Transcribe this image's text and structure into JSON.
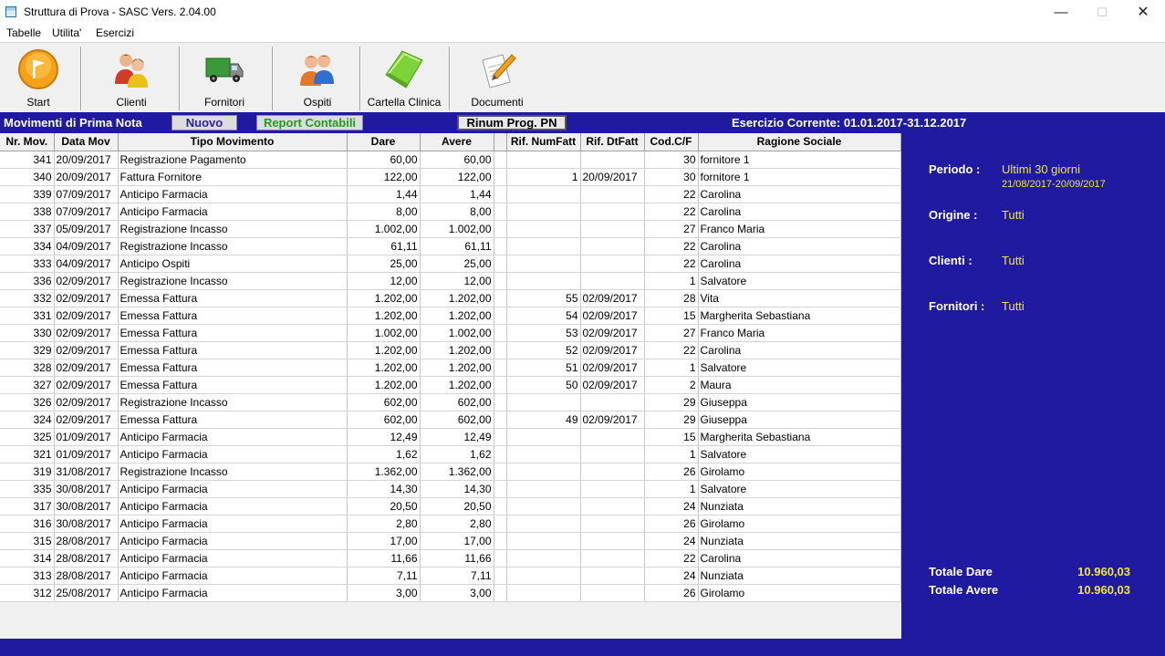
{
  "window": {
    "title": "Struttura di Prova - SASC Vers. 2.04.00",
    "minimize": "—",
    "maximize": "☐",
    "close": "✕"
  },
  "menu": [
    "Tabelle",
    "Utilita'",
    "Esercizi"
  ],
  "toolbar": {
    "start": "Start",
    "clienti": "Clienti",
    "fornitori": "Fornitori",
    "ospiti": "Ospiti",
    "cartella": "Cartella Clinica",
    "documenti": "Documenti"
  },
  "strip": {
    "title": "Movimenti di Prima Nota",
    "nuovo": "Nuovo",
    "report": "Report Contabili",
    "rinum": "Rinum Prog. PN",
    "esercizio": "Esercizio Corrente: 01.01.2017-31.12.2017"
  },
  "columns": [
    "Nr. Mov.",
    "Data Mov",
    "Tipo Movimento",
    "Dare",
    "Avere",
    "",
    "Rif. NumFatt",
    "Rif. DtFatt",
    "Cod.C/F",
    "Ragione Sociale"
  ],
  "rows": [
    [
      "341",
      "20/09/2017",
      "Registrazione Pagamento",
      "60,00",
      "60,00",
      "",
      "",
      "",
      "30",
      "fornitore 1"
    ],
    [
      "340",
      "20/09/2017",
      "Fattura Fornitore",
      "122,00",
      "122,00",
      "",
      "1",
      "20/09/2017",
      "30",
      "fornitore 1"
    ],
    [
      "339",
      "07/09/2017",
      "Anticipo Farmacia",
      "1,44",
      "1,44",
      "",
      "",
      "",
      "22",
      "Carolina"
    ],
    [
      "338",
      "07/09/2017",
      "Anticipo Farmacia",
      "8,00",
      "8,00",
      "",
      "",
      "",
      "22",
      "Carolina"
    ],
    [
      "337",
      "05/09/2017",
      "Registrazione Incasso",
      "1.002,00",
      "1.002,00",
      "",
      "",
      "",
      "27",
      "Franco Maria"
    ],
    [
      "334",
      "04/09/2017",
      "Registrazione Incasso",
      "61,11",
      "61,11",
      "",
      "",
      "",
      "22",
      "Carolina"
    ],
    [
      "333",
      "04/09/2017",
      "Anticipo Ospiti",
      "25,00",
      "25,00",
      "",
      "",
      "",
      "22",
      "Carolina"
    ],
    [
      "336",
      "02/09/2017",
      "Registrazione Incasso",
      "12,00",
      "12,00",
      "",
      "",
      "",
      "1",
      "Salvatore"
    ],
    [
      "332",
      "02/09/2017",
      "Emessa Fattura",
      "1.202,00",
      "1.202,00",
      "",
      "55",
      "02/09/2017",
      "28",
      "Vita"
    ],
    [
      "331",
      "02/09/2017",
      "Emessa Fattura",
      "1.202,00",
      "1.202,00",
      "",
      "54",
      "02/09/2017",
      "15",
      "Margherita Sebastiana"
    ],
    [
      "330",
      "02/09/2017",
      "Emessa Fattura",
      "1.002,00",
      "1.002,00",
      "",
      "53",
      "02/09/2017",
      "27",
      "Franco Maria"
    ],
    [
      "329",
      "02/09/2017",
      "Emessa Fattura",
      "1.202,00",
      "1.202,00",
      "",
      "52",
      "02/09/2017",
      "22",
      "Carolina"
    ],
    [
      "328",
      "02/09/2017",
      "Emessa Fattura",
      "1.202,00",
      "1.202,00",
      "",
      "51",
      "02/09/2017",
      "1",
      "Salvatore"
    ],
    [
      "327",
      "02/09/2017",
      "Emessa Fattura",
      "1.202,00",
      "1.202,00",
      "",
      "50",
      "02/09/2017",
      "2",
      "Maura"
    ],
    [
      "326",
      "02/09/2017",
      "Registrazione Incasso",
      "602,00",
      "602,00",
      "",
      "",
      "",
      "29",
      "Giuseppa"
    ],
    [
      "324",
      "02/09/2017",
      "Emessa Fattura",
      "602,00",
      "602,00",
      "",
      "49",
      "02/09/2017",
      "29",
      "Giuseppa"
    ],
    [
      "325",
      "01/09/2017",
      "Anticipo Farmacia",
      "12,49",
      "12,49",
      "",
      "",
      "",
      "15",
      "Margherita Sebastiana"
    ],
    [
      "321",
      "01/09/2017",
      "Anticipo Farmacia",
      "1,62",
      "1,62",
      "",
      "",
      "",
      "1",
      "Salvatore"
    ],
    [
      "319",
      "31/08/2017",
      "Registrazione Incasso",
      "1.362,00",
      "1.362,00",
      "",
      "",
      "",
      "26",
      "Girolamo"
    ],
    [
      "335",
      "30/08/2017",
      "Anticipo Farmacia",
      "14,30",
      "14,30",
      "",
      "",
      "",
      "1",
      "Salvatore"
    ],
    [
      "317",
      "30/08/2017",
      "Anticipo Farmacia",
      "20,50",
      "20,50",
      "",
      "",
      "",
      "24",
      "Nunziata"
    ],
    [
      "316",
      "30/08/2017",
      "Anticipo Farmacia",
      "2,80",
      "2,80",
      "",
      "",
      "",
      "26",
      "Girolamo"
    ],
    [
      "315",
      "28/08/2017",
      "Anticipo Farmacia",
      "17,00",
      "17,00",
      "",
      "",
      "",
      "24",
      "Nunziata"
    ],
    [
      "314",
      "28/08/2017",
      "Anticipo Farmacia",
      "11,66",
      "11,66",
      "",
      "",
      "",
      "22",
      "Carolina"
    ],
    [
      "313",
      "28/08/2017",
      "Anticipo Farmacia",
      "7,11",
      "7,11",
      "",
      "",
      "",
      "24",
      "Nunziata"
    ],
    [
      "312",
      "25/08/2017",
      "Anticipo Farmacia",
      "3,00",
      "3,00",
      "",
      "",
      "",
      "26",
      "Girolamo"
    ]
  ],
  "side": {
    "periodo_label": "Periodo :",
    "periodo_value": "Ultimi 30 giorni",
    "periodo_range": "21/08/2017-20/09/2017",
    "origine_label": "Origine :",
    "origine_value": "Tutti",
    "clienti_label": "Clienti :",
    "clienti_value": "Tutti",
    "fornitori_label": "Fornitori :",
    "fornitori_value": "Tutti",
    "totale_dare_label": "Totale Dare",
    "totale_dare_value": "10.960,03",
    "totale_avere_label": "Totale Avere",
    "totale_avere_value": "10.960,03"
  },
  "colors": {
    "panel_blue": "#1f1aa0",
    "highlight_yellow": "#f0e63c",
    "report_green": "#1f9c1f"
  }
}
